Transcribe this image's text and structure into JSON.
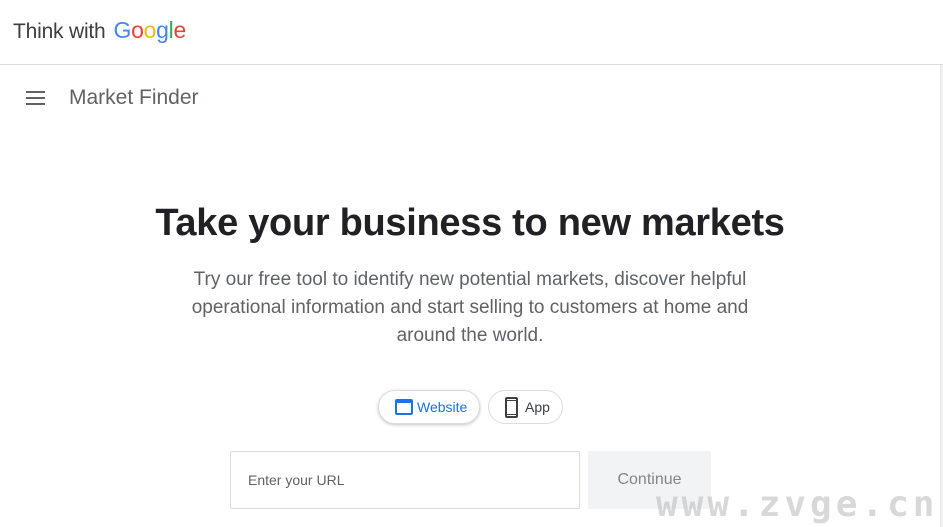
{
  "header": {
    "brand_text": "Think with",
    "brand_logo": [
      "G",
      "o",
      "o",
      "g",
      "l",
      "e"
    ]
  },
  "nav": {
    "menu_icon": "hamburger-menu-icon",
    "product_title": "Market Finder"
  },
  "hero": {
    "title": "Take your business to new markets",
    "subtitle": "Try our free tool to identify new potential markets, discover helpful operational information and start selling to customers at home and around the world."
  },
  "toggle": {
    "selected": "website",
    "website_label": "Website",
    "website_icon": "browser-window-icon",
    "app_label": "App",
    "app_icon": "smartphone-icon"
  },
  "form": {
    "url_value": "",
    "url_placeholder": "Enter your URL",
    "continue_label": "Continue"
  },
  "watermark": "www.zvge.cn",
  "colors": {
    "google_blue": "#4285f4",
    "google_red": "#ea4335",
    "google_yellow": "#fbbc05",
    "google_green": "#34a853",
    "accent": "#1a73e8"
  }
}
